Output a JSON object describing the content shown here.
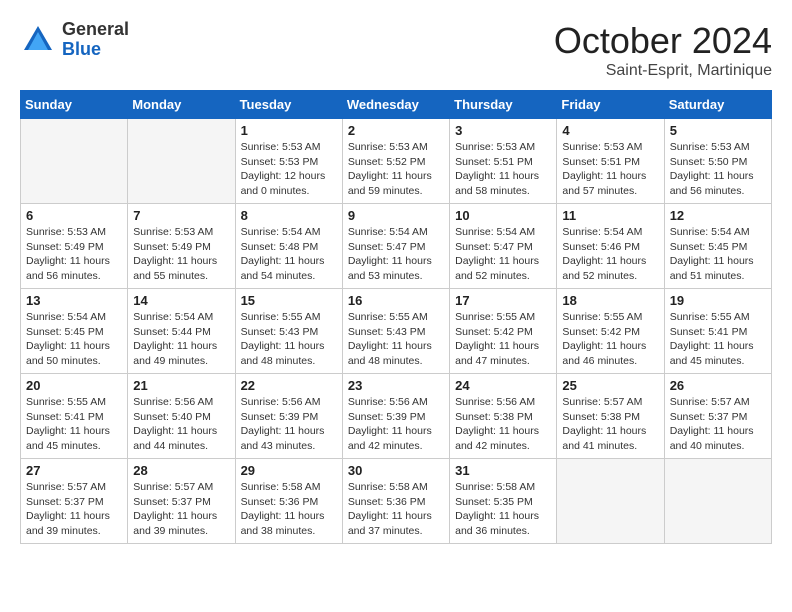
{
  "logo": {
    "general": "General",
    "blue": "Blue"
  },
  "title": "October 2024",
  "subtitle": "Saint-Esprit, Martinique",
  "days_header": [
    "Sunday",
    "Monday",
    "Tuesday",
    "Wednesday",
    "Thursday",
    "Friday",
    "Saturday"
  ],
  "weeks": [
    [
      {
        "day": "",
        "detail": ""
      },
      {
        "day": "",
        "detail": ""
      },
      {
        "day": "1",
        "detail": "Sunrise: 5:53 AM\nSunset: 5:53 PM\nDaylight: 12 hours\nand 0 minutes."
      },
      {
        "day": "2",
        "detail": "Sunrise: 5:53 AM\nSunset: 5:52 PM\nDaylight: 11 hours\nand 59 minutes."
      },
      {
        "day": "3",
        "detail": "Sunrise: 5:53 AM\nSunset: 5:51 PM\nDaylight: 11 hours\nand 58 minutes."
      },
      {
        "day": "4",
        "detail": "Sunrise: 5:53 AM\nSunset: 5:51 PM\nDaylight: 11 hours\nand 57 minutes."
      },
      {
        "day": "5",
        "detail": "Sunrise: 5:53 AM\nSunset: 5:50 PM\nDaylight: 11 hours\nand 56 minutes."
      }
    ],
    [
      {
        "day": "6",
        "detail": "Sunrise: 5:53 AM\nSunset: 5:49 PM\nDaylight: 11 hours\nand 56 minutes."
      },
      {
        "day": "7",
        "detail": "Sunrise: 5:53 AM\nSunset: 5:49 PM\nDaylight: 11 hours\nand 55 minutes."
      },
      {
        "day": "8",
        "detail": "Sunrise: 5:54 AM\nSunset: 5:48 PM\nDaylight: 11 hours\nand 54 minutes."
      },
      {
        "day": "9",
        "detail": "Sunrise: 5:54 AM\nSunset: 5:47 PM\nDaylight: 11 hours\nand 53 minutes."
      },
      {
        "day": "10",
        "detail": "Sunrise: 5:54 AM\nSunset: 5:47 PM\nDaylight: 11 hours\nand 52 minutes."
      },
      {
        "day": "11",
        "detail": "Sunrise: 5:54 AM\nSunset: 5:46 PM\nDaylight: 11 hours\nand 52 minutes."
      },
      {
        "day": "12",
        "detail": "Sunrise: 5:54 AM\nSunset: 5:45 PM\nDaylight: 11 hours\nand 51 minutes."
      }
    ],
    [
      {
        "day": "13",
        "detail": "Sunrise: 5:54 AM\nSunset: 5:45 PM\nDaylight: 11 hours\nand 50 minutes."
      },
      {
        "day": "14",
        "detail": "Sunrise: 5:54 AM\nSunset: 5:44 PM\nDaylight: 11 hours\nand 49 minutes."
      },
      {
        "day": "15",
        "detail": "Sunrise: 5:55 AM\nSunset: 5:43 PM\nDaylight: 11 hours\nand 48 minutes."
      },
      {
        "day": "16",
        "detail": "Sunrise: 5:55 AM\nSunset: 5:43 PM\nDaylight: 11 hours\nand 48 minutes."
      },
      {
        "day": "17",
        "detail": "Sunrise: 5:55 AM\nSunset: 5:42 PM\nDaylight: 11 hours\nand 47 minutes."
      },
      {
        "day": "18",
        "detail": "Sunrise: 5:55 AM\nSunset: 5:42 PM\nDaylight: 11 hours\nand 46 minutes."
      },
      {
        "day": "19",
        "detail": "Sunrise: 5:55 AM\nSunset: 5:41 PM\nDaylight: 11 hours\nand 45 minutes."
      }
    ],
    [
      {
        "day": "20",
        "detail": "Sunrise: 5:55 AM\nSunset: 5:41 PM\nDaylight: 11 hours\nand 45 minutes."
      },
      {
        "day": "21",
        "detail": "Sunrise: 5:56 AM\nSunset: 5:40 PM\nDaylight: 11 hours\nand 44 minutes."
      },
      {
        "day": "22",
        "detail": "Sunrise: 5:56 AM\nSunset: 5:39 PM\nDaylight: 11 hours\nand 43 minutes."
      },
      {
        "day": "23",
        "detail": "Sunrise: 5:56 AM\nSunset: 5:39 PM\nDaylight: 11 hours\nand 42 minutes."
      },
      {
        "day": "24",
        "detail": "Sunrise: 5:56 AM\nSunset: 5:38 PM\nDaylight: 11 hours\nand 42 minutes."
      },
      {
        "day": "25",
        "detail": "Sunrise: 5:57 AM\nSunset: 5:38 PM\nDaylight: 11 hours\nand 41 minutes."
      },
      {
        "day": "26",
        "detail": "Sunrise: 5:57 AM\nSunset: 5:37 PM\nDaylight: 11 hours\nand 40 minutes."
      }
    ],
    [
      {
        "day": "27",
        "detail": "Sunrise: 5:57 AM\nSunset: 5:37 PM\nDaylight: 11 hours\nand 39 minutes."
      },
      {
        "day": "28",
        "detail": "Sunrise: 5:57 AM\nSunset: 5:37 PM\nDaylight: 11 hours\nand 39 minutes."
      },
      {
        "day": "29",
        "detail": "Sunrise: 5:58 AM\nSunset: 5:36 PM\nDaylight: 11 hours\nand 38 minutes."
      },
      {
        "day": "30",
        "detail": "Sunrise: 5:58 AM\nSunset: 5:36 PM\nDaylight: 11 hours\nand 37 minutes."
      },
      {
        "day": "31",
        "detail": "Sunrise: 5:58 AM\nSunset: 5:35 PM\nDaylight: 11 hours\nand 36 minutes."
      },
      {
        "day": "",
        "detail": ""
      },
      {
        "day": "",
        "detail": ""
      }
    ]
  ]
}
